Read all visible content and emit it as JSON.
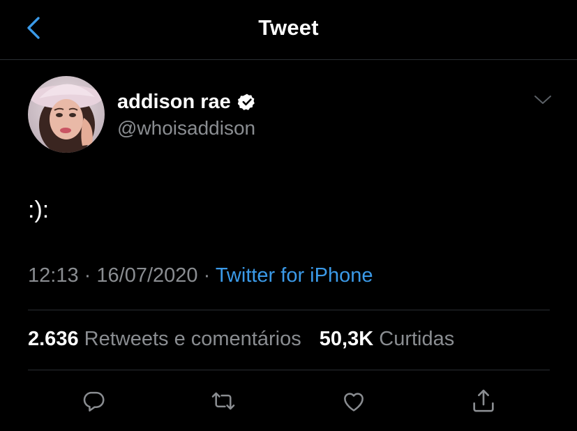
{
  "header": {
    "title": "Tweet",
    "back_icon": "chevron-left-icon",
    "accent_color": "#3b9ae8"
  },
  "author": {
    "name": "addison rae",
    "handle": "@whoisaddison",
    "verified": true,
    "verified_icon": "verified-badge-icon"
  },
  "tweet": {
    "text": ":):",
    "time": "12:13",
    "separator": "·",
    "date": "16/07/2020",
    "source": "Twitter for iPhone"
  },
  "stats": {
    "retweets_count": "2.636",
    "retweets_label": "Retweets e comentários",
    "likes_count": "50,3K",
    "likes_label": "Curtidas"
  },
  "actions": [
    "reply-icon",
    "retweet-icon",
    "like-icon",
    "share-icon"
  ],
  "colors": {
    "background": "#000000",
    "text_primary": "#ffffff",
    "text_secondary": "#8a8d91",
    "link": "#3b9ae8",
    "divider": "#2a2e33"
  }
}
